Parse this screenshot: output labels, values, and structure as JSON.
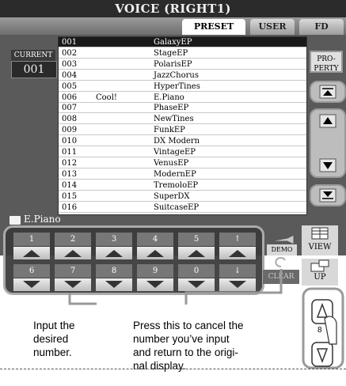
{
  "screen": {
    "title": "VOICE (RIGHT1)",
    "tabs": [
      {
        "label": "PRESET",
        "active": true
      },
      {
        "label": "USER",
        "active": false
      },
      {
        "label": "FD",
        "active": false
      }
    ],
    "current_label": "CURRENT",
    "current_value": "001",
    "voices": [
      {
        "num": "001",
        "note": "",
        "name": "GalaxyEP",
        "selected": true
      },
      {
        "num": "002",
        "note": "",
        "name": "StageEP"
      },
      {
        "num": "003",
        "note": "",
        "name": "PolarisEP"
      },
      {
        "num": "004",
        "note": "",
        "name": "JazzChorus"
      },
      {
        "num": "005",
        "note": "",
        "name": "HyperTines"
      },
      {
        "num": "006",
        "note": "Cool!",
        "name": "E.Piano"
      },
      {
        "num": "007",
        "note": "",
        "name": "PhaseEP"
      },
      {
        "num": "008",
        "note": "",
        "name": "NewTines"
      },
      {
        "num": "009",
        "note": "",
        "name": "FunkEP"
      },
      {
        "num": "010",
        "note": "",
        "name": "DX Modern"
      },
      {
        "num": "011",
        "note": "",
        "name": "VintageEP"
      },
      {
        "num": "012",
        "note": "",
        "name": "VenusEP"
      },
      {
        "num": "013",
        "note": "",
        "name": "ModernEP"
      },
      {
        "num": "014",
        "note": "",
        "name": "TremoloEP"
      },
      {
        "num": "015",
        "note": "",
        "name": "SuperDX"
      },
      {
        "num": "016",
        "note": "",
        "name": "SuitcaseEP"
      }
    ],
    "folder_path": "E.Piano",
    "numpad_keys": [
      "1",
      "2",
      "3",
      "4",
      "5",
      "↑",
      "6",
      "7",
      "8",
      "9",
      "0",
      "↓"
    ],
    "demo_label": "DEMO",
    "clear_label": "CLEAR",
    "property_label": "PRO-\nPERTY",
    "view_label": "VIEW",
    "up_label": "UP"
  },
  "captions": {
    "left": [
      "Input the",
      "desired",
      "number."
    ],
    "middle": [
      "Press this to cancel the",
      "number you’ve input",
      "and return to the origi-",
      "nal display."
    ]
  },
  "dial": {
    "label": "8"
  }
}
